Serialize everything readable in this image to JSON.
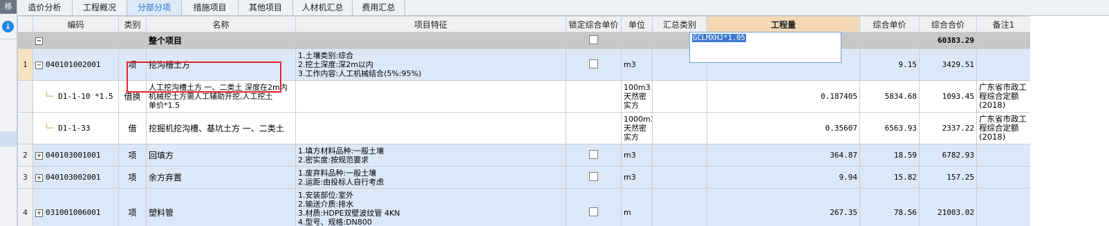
{
  "left_strip": {
    "tab_label": "移",
    "download_icon": "download-icon"
  },
  "tabs": [
    {
      "label": "造价分析",
      "active": false
    },
    {
      "label": "工程概况",
      "active": false
    },
    {
      "label": "分部分项",
      "active": true
    },
    {
      "label": "措施项目",
      "active": false
    },
    {
      "label": "其他项目",
      "active": false
    },
    {
      "label": "人材机汇总",
      "active": false
    },
    {
      "label": "费用汇总",
      "active": false
    }
  ],
  "columns": {
    "code": "编码",
    "type": "类别",
    "name": "名称",
    "feature": "项目特征",
    "lock": "锁定综合单价",
    "unit": "单位",
    "summary": "汇总类别",
    "qty": "工程量",
    "unit_price": "综合单价",
    "total": "综合合价",
    "remark": "备注1"
  },
  "total_row": {
    "toggle": "−",
    "name": "整个项目",
    "total": "60383.29"
  },
  "rows": [
    {
      "rownum": "1",
      "toggle": "−",
      "code": "040101002001",
      "type": "项",
      "name": "挖沟槽土方",
      "features": [
        "1.土壤类别:综合",
        "2.挖土深度:深2m以内",
        "3.工作内容:人工机械结合(5%:95%)"
      ],
      "unit": "m3",
      "qty": "GCLMXHJ*1.05",
      "unit_price": "9.15",
      "total": "3429.51",
      "remark": ""
    },
    {
      "rownum": "",
      "code": "D1-1-10 *1.5",
      "type": "借换",
      "name_lines": [
        "人工挖沟槽土方 一、二类土 深度在2m内",
        "机械挖土方需人工辅助开挖,人工挖土",
        "单价*1.5"
      ],
      "unit_lines": [
        "100m3",
        "天然密",
        "实方"
      ],
      "qty": "0.187405",
      "unit_price": "5834.68",
      "total": "1093.45",
      "remark_lines": [
        "广东省市政工",
        "程综合定额",
        "(2018)"
      ]
    },
    {
      "rownum": "",
      "code": "D1-1-33",
      "type": "借",
      "name": "挖掘机挖沟槽、基坑土方 一、二类土",
      "unit_lines": [
        "1000m3",
        "天然密",
        "实方"
      ],
      "qty": "0.35607",
      "unit_price": "6563.93",
      "total": "2337.22",
      "remark_lines": [
        "广东省市政工",
        "程综合定额",
        "(2018)"
      ]
    },
    {
      "rownum": "2",
      "toggle": "+",
      "code": "040103001001",
      "type": "项",
      "name": "回填方",
      "features": [
        "1.填方材料品种:一般土壤",
        "2.密实度:按规范要求"
      ],
      "unit": "m3",
      "qty": "364.87",
      "unit_price": "18.59",
      "total": "6782.93",
      "remark": ""
    },
    {
      "rownum": "3",
      "toggle": "+",
      "code": "040103002001",
      "type": "项",
      "name": "余方弃置",
      "features": [
        "1.废弃料品种:一般土壤",
        "2.运距:由投标人自行考虑"
      ],
      "unit": "m3",
      "qty": "9.94",
      "unit_price": "15.82",
      "total": "157.25",
      "remark": ""
    },
    {
      "rownum": "4",
      "toggle": "+",
      "code": "031001006001",
      "type": "项",
      "name": "塑料管",
      "features": [
        "1.安装部位:室外",
        "2.输送介质:排水",
        "3.材质:HDPE双壁波纹管 4KN",
        "4.型号、规格:DN800"
      ],
      "unit": "m",
      "qty": "267.35",
      "unit_price": "78.56",
      "total": "21003.02",
      "remark": ""
    }
  ]
}
